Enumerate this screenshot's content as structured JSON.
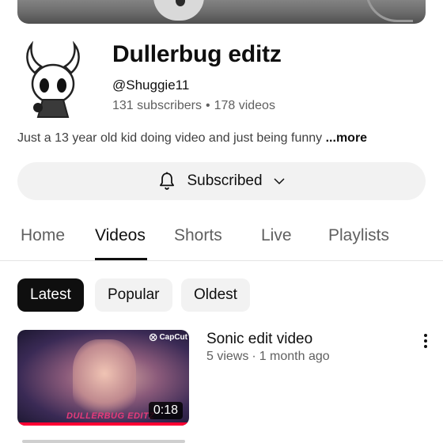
{
  "channel": {
    "name": "Dullerbug editz",
    "handle": "@Shuggie11",
    "subscribers": "131 subscribers",
    "stats_separator": "•",
    "videos_count": "178 videos",
    "description": "Just a 13 year old kid doing video and just being funny",
    "more_label": "...more"
  },
  "subscribe_button": {
    "label": "Subscribed",
    "icon": "bell-icon",
    "dropdown_icon": "chevron-down-icon"
  },
  "tabs": [
    {
      "label": "Home",
      "active": false
    },
    {
      "label": "Videos",
      "active": true
    },
    {
      "label": "Shorts",
      "active": false
    },
    {
      "label": "Live",
      "active": false
    },
    {
      "label": "Playlists",
      "active": false
    }
  ],
  "filters": [
    {
      "label": "Latest",
      "active": true
    },
    {
      "label": "Popular",
      "active": false
    },
    {
      "label": "Oldest",
      "active": false
    }
  ],
  "videos": [
    {
      "title": "Sonic edit video",
      "views": "5 views",
      "separator": "·",
      "age": "1 month ago",
      "duration": "0:18",
      "thumbnail_badge": "CapCut",
      "thumbnail_watermark": "DULLERBUG EDITZ",
      "watch_progress": 1.0
    }
  ],
  "colors": {
    "accent": "#0f0f0f",
    "secondary_text": "#606060",
    "chip_background": "#f2f2f2",
    "progress_red": "#ff0033"
  }
}
